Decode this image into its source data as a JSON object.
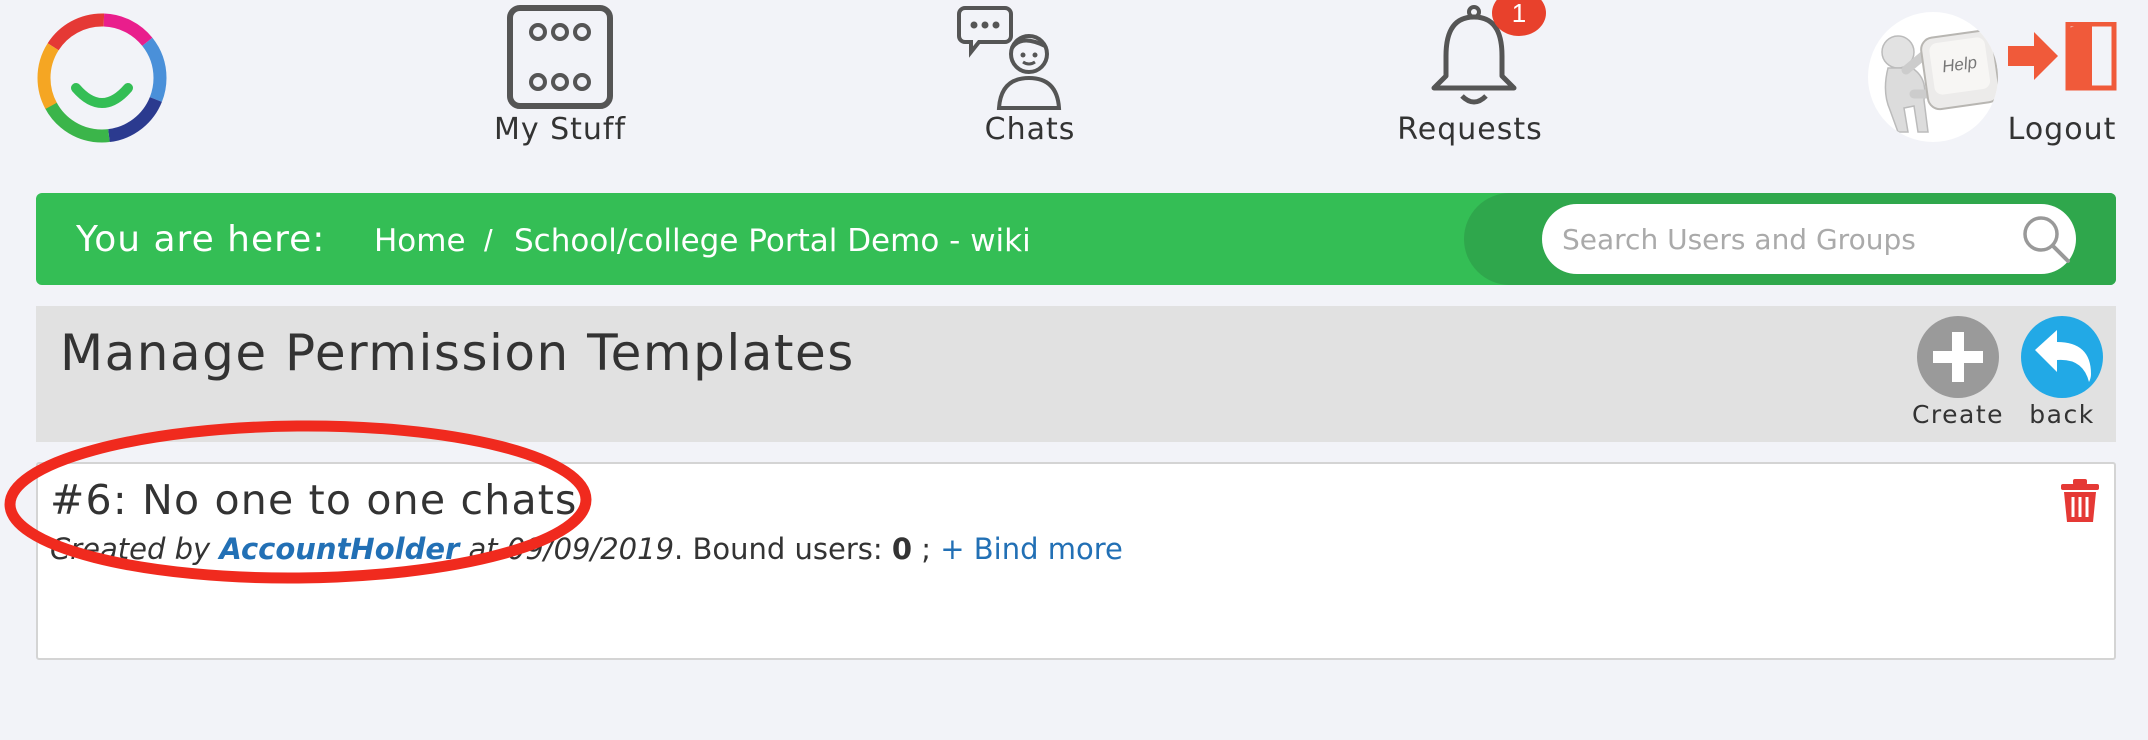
{
  "nav": {
    "my_stuff": "My Stuff",
    "chats": "Chats",
    "requests": "Requests",
    "requests_badge": "1",
    "help_key_text": "Help",
    "logout": "Logout"
  },
  "breadcrumb": {
    "label": "You are here:",
    "items": [
      "Home",
      "School/college Portal Demo - wiki"
    ],
    "separator": "/"
  },
  "search": {
    "placeholder": "Search Users and Groups"
  },
  "page": {
    "title": "Manage Permission Templates",
    "create_label": "Create",
    "back_label": "back"
  },
  "template": {
    "title": "#6: No one to one chats",
    "created_by_prefix": "Created by",
    "author": "AccountHolder",
    "date_prefix": "at",
    "date": "09/09/2019",
    "bound_label": ". Bound users:",
    "bound_count": "0",
    "bound_suffix": ";",
    "bind_more": "+ Bind more"
  },
  "colors": {
    "brand_green": "#34be55",
    "link_blue": "#2270b5",
    "back_blue": "#22a9e6",
    "alert_red": "#e8412c",
    "annotation_red": "#f02a1e"
  },
  "icons": {
    "logo": "ring-smile-logo",
    "my_stuff": "dice-six-icon",
    "chats": "person-chat-icon",
    "requests": "bell-icon",
    "help": "help-figure-icon",
    "logout": "exit-door-icon",
    "search": "search-icon",
    "create": "plus-icon",
    "back": "undo-arrow-icon",
    "delete": "trash-icon"
  }
}
